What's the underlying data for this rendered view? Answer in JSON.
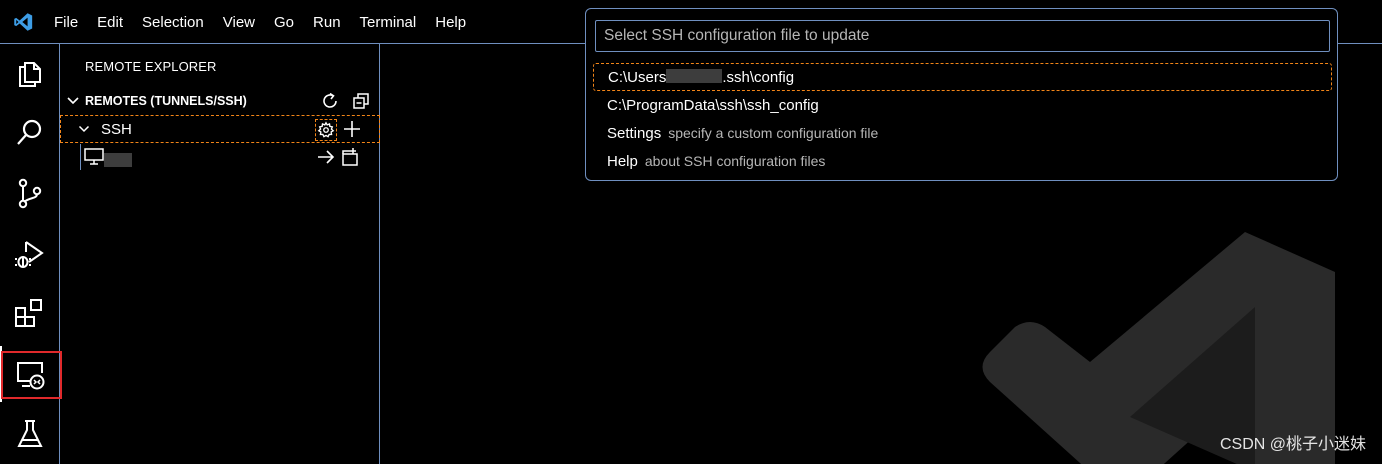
{
  "menu": [
    "File",
    "Edit",
    "Selection",
    "View",
    "Go",
    "Run",
    "Terminal",
    "Help"
  ],
  "activity_bar": [
    "explorer-icon",
    "search-icon",
    "source-control-icon",
    "run-debug-icon",
    "extensions-icon",
    "remote-explorer-icon",
    "testing-icon"
  ],
  "sidebar": {
    "title": "REMOTE EXPLORER",
    "section": "REMOTES (TUNNELS/SSH)",
    "ssh_group": "SSH",
    "host": "••••"
  },
  "quickpick": {
    "placeholder": "Select SSH configuration file to update",
    "items": [
      {
        "label_prefix": "C:\\Users",
        "label_suffix": ".ssh\\config",
        "description": ""
      },
      {
        "label": "C:\\ProgramData\\ssh\\ssh_config",
        "description": ""
      },
      {
        "label": "Settings",
        "description": "specify a custom configuration file"
      },
      {
        "label": "Help",
        "description": "about SSH configuration files"
      }
    ]
  },
  "footer": {
    "credit": "CSDN @桃子小迷妹"
  },
  "colors": {
    "focus_border": "#f38518",
    "panel_border": "#6f8fbf",
    "highlight": "#e0292b",
    "accent": "#3794ff"
  }
}
